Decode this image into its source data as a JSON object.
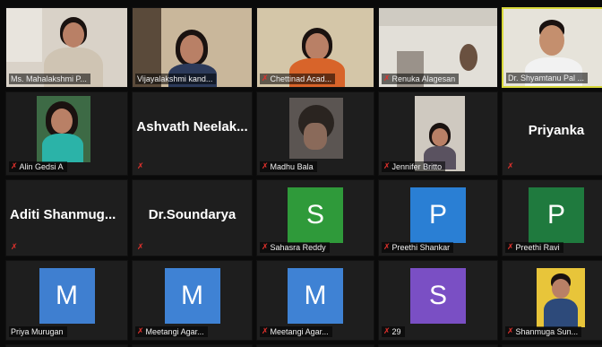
{
  "participants": [
    {
      "name": "Ms. Mahalakshmi P...",
      "type": "video",
      "muted": false
    },
    {
      "name": "Vijayalakshmi kand...",
      "type": "video",
      "muted": false
    },
    {
      "name": "Chettinad Acad...",
      "type": "video",
      "muted": true
    },
    {
      "name": "Renuka Alagesan",
      "type": "video",
      "muted": true
    },
    {
      "name": "Dr. Shyamtanu Pal ...",
      "type": "video",
      "muted": false,
      "active_speaker": true
    },
    {
      "name": "Alin Gedsi A",
      "type": "video",
      "muted": true
    },
    {
      "display_name": "Ashvath  Neelak...",
      "type": "name",
      "muted": true
    },
    {
      "name": "Madhu Bala",
      "type": "photo",
      "muted": true
    },
    {
      "name": "Jennifer Britto",
      "type": "video",
      "muted": true
    },
    {
      "display_name": "Priyanka",
      "type": "name",
      "muted": true
    },
    {
      "display_name": "Aditi  Shanmug...",
      "type": "name",
      "muted": true
    },
    {
      "display_name": "Dr.Soundarya",
      "type": "name",
      "muted": true
    },
    {
      "name": "Sahasra Reddy",
      "initial": "S",
      "avatar_color": "#2f9a3a",
      "type": "avatar",
      "muted": true
    },
    {
      "name": "Preethi Shankar",
      "initial": "P",
      "avatar_color": "#2a7fd4",
      "type": "avatar",
      "muted": true
    },
    {
      "name": "Preethi Ravi",
      "initial": "P",
      "avatar_color": "#1f7a3e",
      "type": "avatar",
      "muted": true
    },
    {
      "name": "Priya Murugan",
      "initial": "M",
      "avatar_color": "#3f7fd0",
      "type": "avatar",
      "muted": false
    },
    {
      "name": "Meetangi Agar...",
      "initial": "M",
      "avatar_color": "#3f82d4",
      "type": "avatar",
      "muted": true
    },
    {
      "name": "Meetangi Agar...",
      "initial": "M",
      "avatar_color": "#3f82d4",
      "type": "avatar",
      "muted": true
    },
    {
      "name": "29",
      "initial": "S",
      "avatar_color": "#7a4fc4",
      "type": "avatar",
      "muted": true
    },
    {
      "name": "Shanmuga Sun...",
      "type": "photo",
      "muted": true
    }
  ],
  "icons": {
    "muted_mic": "muted-mic-icon"
  },
  "colors": {
    "background": "#0a0a0a",
    "tile": "#1e1e1e",
    "active_border": "#d8d83a",
    "muted_red": "#e0312c"
  }
}
